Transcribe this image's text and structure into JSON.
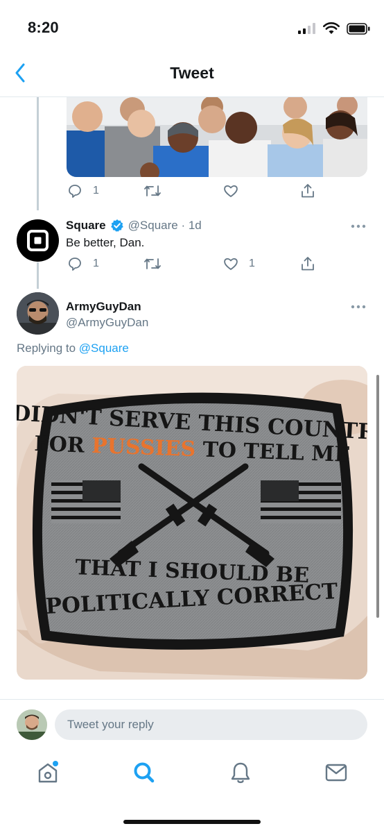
{
  "status": {
    "time": "8:20"
  },
  "header": {
    "title": "Tweet"
  },
  "parent_tweet": {
    "reply_count": "1",
    "retweet_count": "",
    "like_count": ""
  },
  "square_tweet": {
    "name": "Square",
    "handle": "@Square",
    "separator": " · ",
    "age": "1d",
    "text": "Be better, Dan.",
    "reply_count": "1",
    "retweet_count": "",
    "like_count": "1"
  },
  "main_tweet": {
    "name": "ArmyGuyDan",
    "handle": "@ArmyGuyDan",
    "replying_prefix": "Replying to ",
    "replying_to": "@Square",
    "patch_text": {
      "line1": "I DIDN'T SERVE THIS COUNTRY",
      "line2_a": "FOR ",
      "line2_b": "PUSSIES",
      "line2_c": " TO TELL ME",
      "line3": "THAT I SHOULD BE",
      "line4": "POLITICALLY CORRECT"
    }
  },
  "reply_bar": {
    "placeholder": "Tweet your reply"
  },
  "colors": {
    "accent": "#1da1f2",
    "verified": "#1da1f2",
    "icon_gray": "#657786",
    "patch_orange": "#e8742e"
  },
  "icons": [
    "back-chevron-icon",
    "reply-icon",
    "retweet-icon",
    "like-icon",
    "share-icon",
    "verified-icon",
    "more-icon",
    "home-icon",
    "search-icon",
    "notifications-icon",
    "messages-icon"
  ]
}
